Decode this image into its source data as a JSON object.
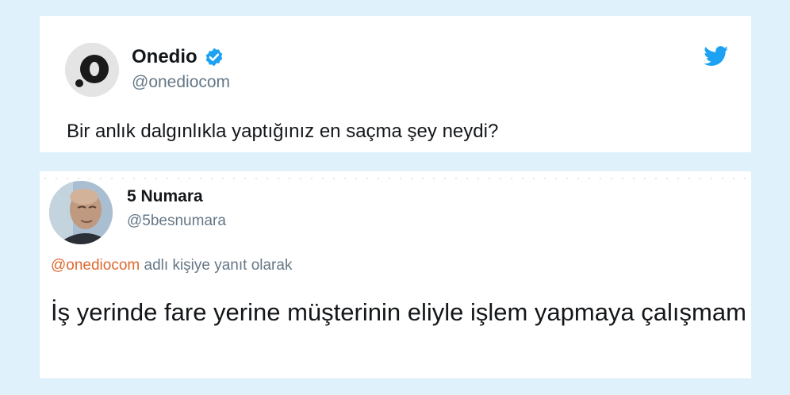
{
  "tweet_main": {
    "author_name": "Onedio",
    "author_handle": "@onediocom",
    "text": "Bir anlık dalgınlıkla yaptığınız en saçma şey neydi?",
    "verified_icon": "verified-badge",
    "brand_icon": "twitter-bird",
    "colors": {
      "verified": "#1da1f2",
      "bird": "#1da1f2"
    }
  },
  "tweet_reply": {
    "author_name": "5 Numara",
    "author_handle": "@5besnumara",
    "reply_mention": "@onediocom",
    "reply_suffix": " adlı kişiye yanıt olarak",
    "text": "İş yerinde fare yerine müşterinin eliyle işlem yapmaya çalışmam",
    "colors": {
      "mention": "#e0682f"
    }
  }
}
